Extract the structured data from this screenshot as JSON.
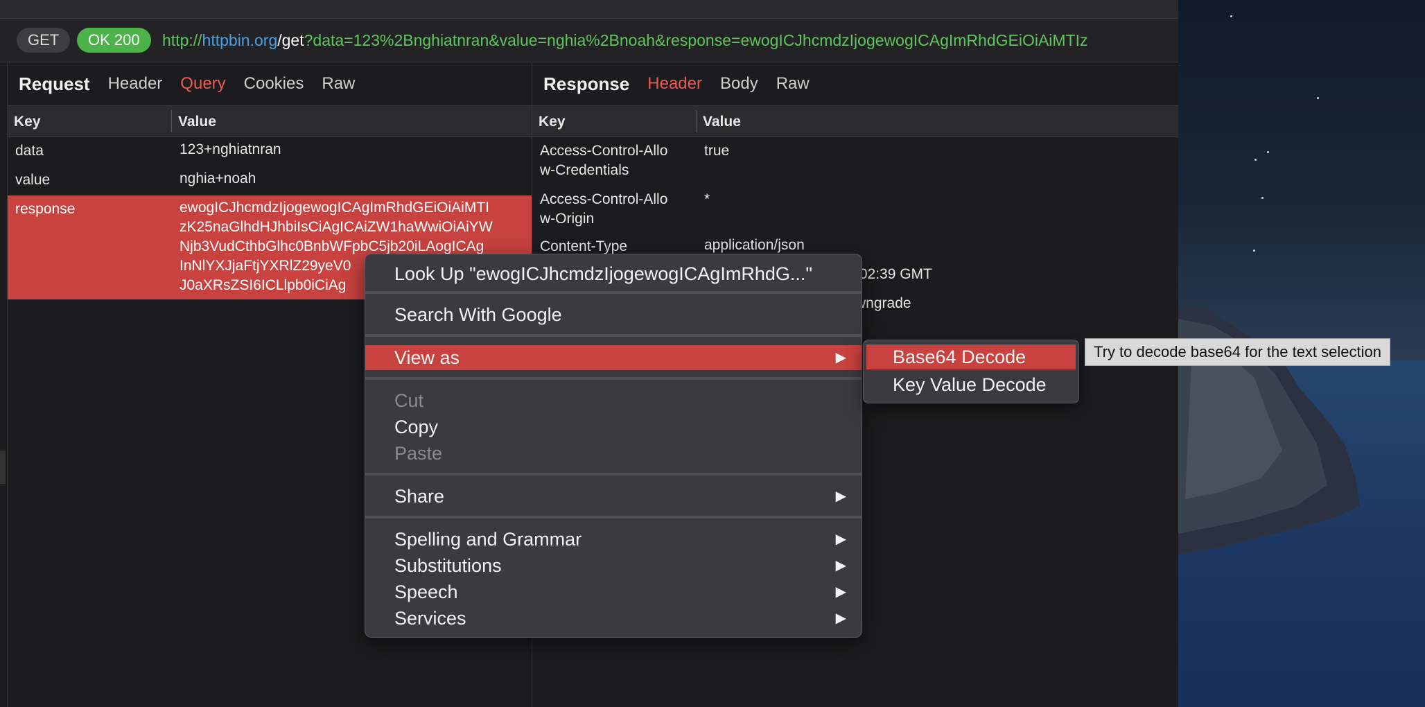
{
  "urlbar": {
    "method": "GET",
    "status": "OK 200",
    "url_scheme": "http://",
    "url_host": "httpbin.org",
    "url_path": "/get",
    "url_query": "?data=123%2Bnghiatnran&value=nghia%2Bnoah&response=ewogICJhcmdzIjogewogICAgImRhdGEiOiAiMTIz"
  },
  "request": {
    "title": "Request",
    "tabs": [
      "Header",
      "Query",
      "Cookies",
      "Raw"
    ],
    "active_tab": "Query",
    "columns": {
      "key": "Key",
      "value": "Value"
    },
    "rows": [
      {
        "key": "data",
        "value": [
          "123+nghiatnran"
        ]
      },
      {
        "key": "value",
        "value": [
          "nghia+noah"
        ]
      },
      {
        "key": "response",
        "value": [
          "ewogICJhcmdzIjogewogICAgImRhdGEiOiAiMTI",
          "zK25naGlhdHJhbiIsCiAgICAiZW1haWwiOiAiYW",
          "Njb3VudCthbGlhc0BnbWFpbC5jb20iLAogICAg",
          "InNlYXJjaFtjYXRlZ29yeV0",
          "J0aXRsZSI6ICLlpb0iCiAg"
        ]
      }
    ]
  },
  "response": {
    "title": "Response",
    "tabs": [
      "Header",
      "Body",
      "Raw"
    ],
    "active_tab": "Header",
    "columns": {
      "key": "Key",
      "value": "Value"
    },
    "rows": [
      {
        "key": [
          "Access-Control-Allo",
          "w-Credentials"
        ],
        "value": "true"
      },
      {
        "key": [
          "Access-Control-Allo",
          "w-Origin"
        ],
        "value": "*"
      },
      {
        "key": [
          "Content-Type"
        ],
        "value": "application/json"
      },
      {
        "key": [
          ""
        ],
        "value": ":02:39 GMT"
      },
      {
        "key": [
          ""
        ],
        "value": "wngrade"
      }
    ]
  },
  "context_menu": {
    "look_up": "Look Up \"ewogICJhcmdzIjogewogICAgImRhdG...\"",
    "search_google": "Search With Google",
    "view_as": "View as",
    "cut": "Cut",
    "copy": "Copy",
    "paste": "Paste",
    "share": "Share",
    "spelling": "Spelling and Grammar",
    "substitutions": "Substitutions",
    "speech": "Speech",
    "services": "Services",
    "submenu_arrow": "▶"
  },
  "submenu": {
    "base64": "Base64 Decode",
    "key_value": "Key Value Decode"
  },
  "tooltip": "Try to decode base64 for the text selection",
  "colors": {
    "accent": "#c8423f",
    "status_ok": "#4cb34a",
    "url_host": "#4a9fe6"
  }
}
